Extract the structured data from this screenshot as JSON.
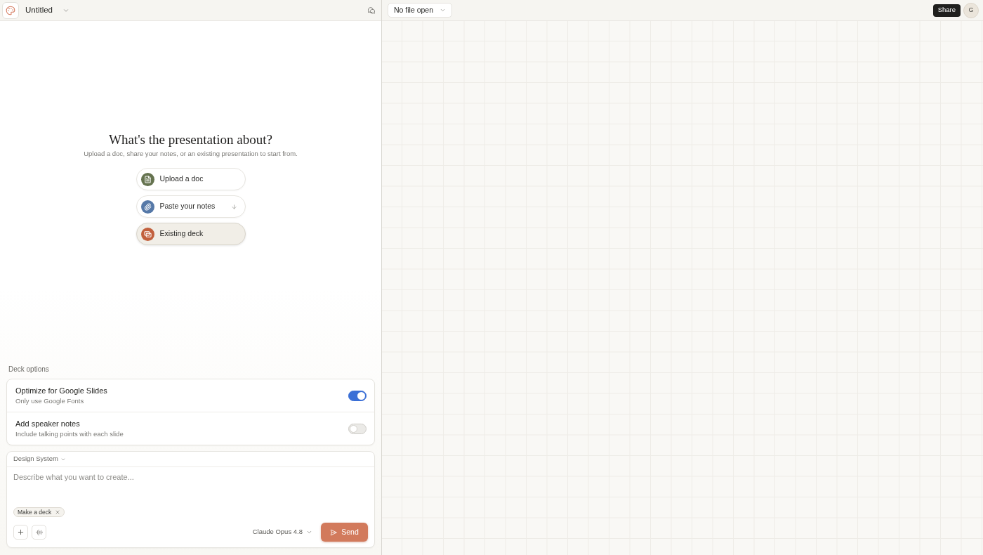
{
  "left_header": {
    "title": "Untitled"
  },
  "right_header": {
    "file_menu": "No file open",
    "share_button": "Share",
    "avatar": "G"
  },
  "hero": {
    "title": "What's the presentation about?",
    "subtitle": "Upload a doc, share your notes, or an existing presentation to start from."
  },
  "start_options": [
    {
      "kind": "upload",
      "label": "Upload a doc",
      "color": "#65734f",
      "expandable": false,
      "selected": false
    },
    {
      "kind": "paste",
      "label": "Paste your notes",
      "color": "#5679a8",
      "expandable": true,
      "selected": false
    },
    {
      "kind": "deck",
      "label": "Existing deck",
      "color": "#c2603d",
      "expandable": false,
      "selected": true
    }
  ],
  "deck_options": {
    "title": "Deck options",
    "items": [
      {
        "label": "Optimize for Google Slides",
        "description": "Only use Google Fonts",
        "on": true
      },
      {
        "label": "Add speaker notes",
        "description": "Include talking points with each slide",
        "on": false
      }
    ]
  },
  "composer": {
    "design_system": "Design System",
    "placeholder": "Describe what you want to create...",
    "chips": [
      {
        "label": "Make a deck"
      }
    ],
    "model": "Claude Opus 4.8",
    "send_button": "Send"
  }
}
